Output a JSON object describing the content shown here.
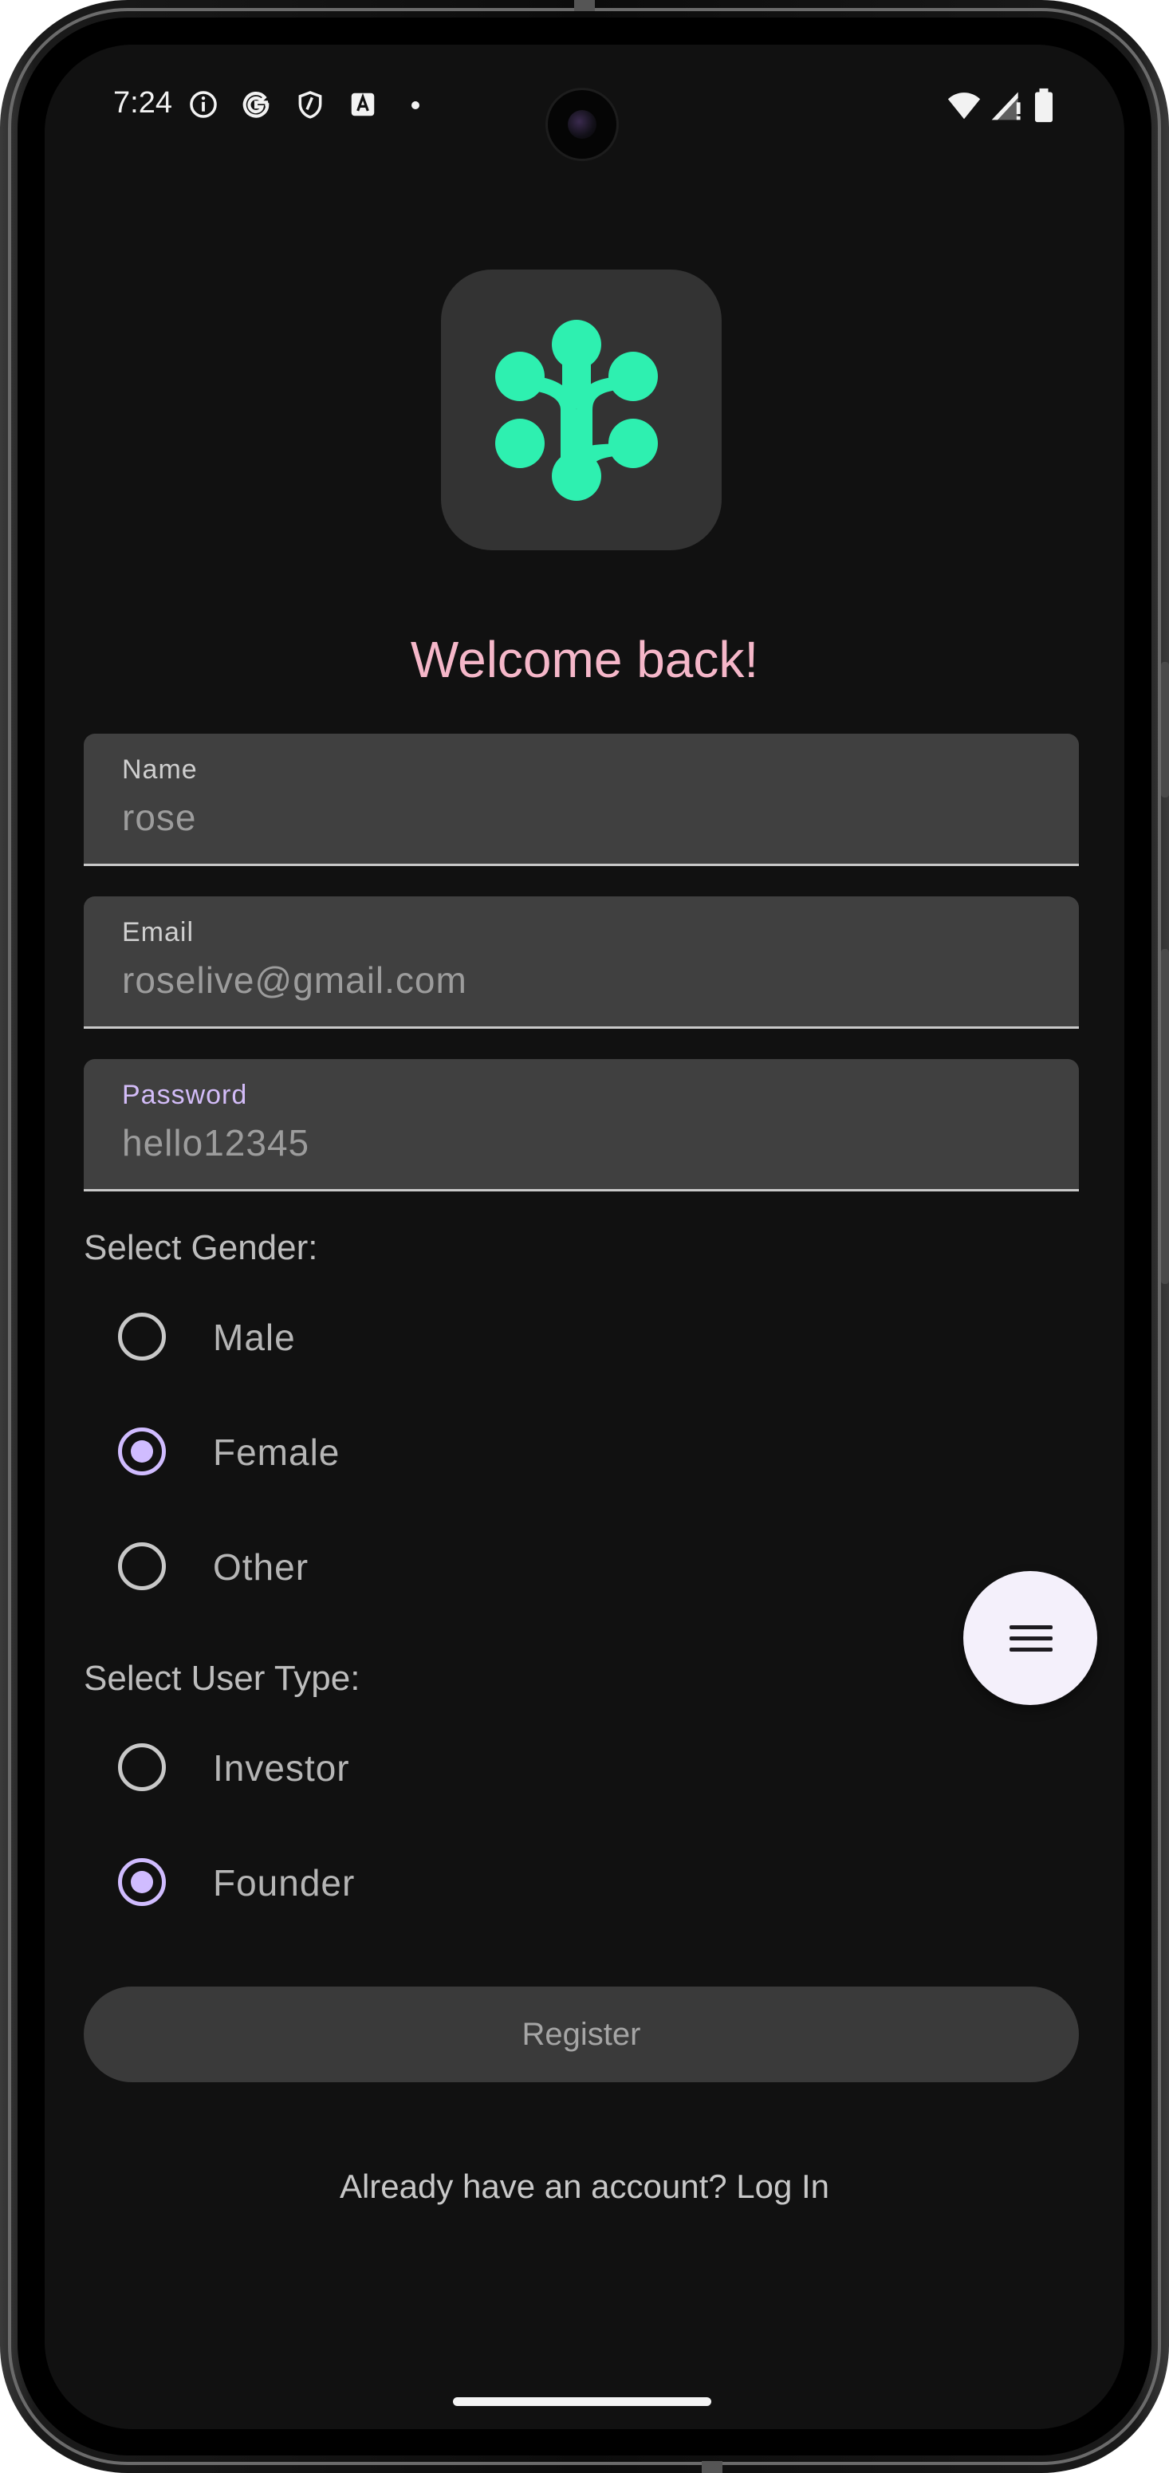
{
  "status_bar": {
    "time": "7:24",
    "left_icons": [
      "info-icon",
      "google-g-icon",
      "shield-icon",
      "font-a-icon",
      "dot-icon"
    ],
    "right_icons": [
      "wifi-icon",
      "cell-signal-icon",
      "battery-icon"
    ]
  },
  "app": {
    "logo_icon": "molecule-dots-logo",
    "logo_color": "#2ef0b0",
    "welcome_text": "Welcome back!",
    "welcome_color": "#f5b7c9",
    "accent_color": "#d0bcff"
  },
  "form": {
    "name": {
      "label": "Name",
      "value": "rose"
    },
    "email": {
      "label": "Email",
      "value": "roselive@gmail.com"
    },
    "password": {
      "label": "Password",
      "value": "hello12345",
      "focused": true
    }
  },
  "gender": {
    "heading": "Select Gender:",
    "options": [
      {
        "label": "Male",
        "selected": false
      },
      {
        "label": "Female",
        "selected": true
      },
      {
        "label": "Other",
        "selected": false
      }
    ]
  },
  "user_type": {
    "heading": "Select User Type:",
    "options": [
      {
        "label": "Investor",
        "selected": false
      },
      {
        "label": "Founder",
        "selected": true
      }
    ]
  },
  "fab": {
    "icon": "menu-icon"
  },
  "register_button": {
    "label": "Register",
    "enabled": false
  },
  "login_link": {
    "text": "Already have an account? Log In"
  }
}
